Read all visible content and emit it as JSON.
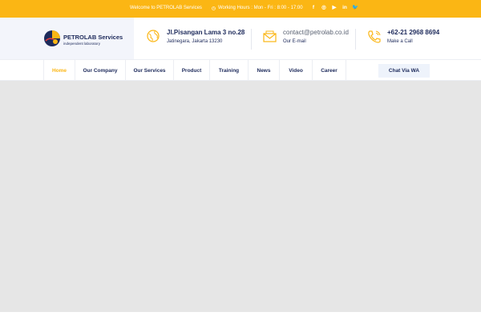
{
  "topbar": {
    "welcome": "Welcome to PETROLAB Services",
    "hours": "Working Hours : Mon - Fri : 8:00 - 17:00",
    "social": [
      "f",
      "◎",
      "▶",
      "in",
      "🐦"
    ]
  },
  "brand": {
    "name": "PETROLAB Services",
    "tagline": "independent laboratory"
  },
  "contact": {
    "address_line1": "Jl.Pisangan Lama 3 no.28",
    "address_line2": "Jatinegara, Jakarta 13230",
    "email": "contact@petrolab.co.id",
    "email_label": "Our E-mail",
    "phone": "+62-21 2968 8694",
    "phone_label": "Make a Call"
  },
  "nav": {
    "items": [
      "Home",
      "Our Company",
      "Our Services",
      "Product",
      "Training",
      "News",
      "Video",
      "Career"
    ],
    "cta": "Chat Via WA"
  },
  "colors": {
    "accent": "#fbb614",
    "navy": "#1d2a5b",
    "content_bg": "#e6e6e6"
  },
  "icons": {
    "address": "globe-icon",
    "email": "envelope-icon",
    "phone": "phone-icon",
    "hours": "clock-icon"
  }
}
